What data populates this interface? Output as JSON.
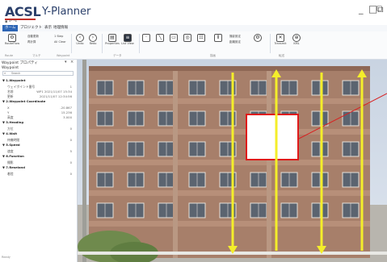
{
  "app": {
    "logo": "ACSL",
    "name": "Y-Planner"
  },
  "window": {
    "minimize_glyph": "_",
    "maximize_glyph": "□",
    "restore_glyph": "⧉"
  },
  "quick_access": "▪ ↶ ↷",
  "menu": {
    "tabs": [
      "ホーム",
      "プロジェクト",
      "表示",
      "地理情報"
    ],
    "active_index": 0
  },
  "ribbon": {
    "buttons": [
      {
        "label": "RouteFlow",
        "icon": "route-icon"
      },
      {
        "label": "ルート作成",
        "icon": "route-create-icon"
      },
      {
        "label": "1 Step",
        "icon": "step-icon"
      },
      {
        "label": "All Clear",
        "icon": "clear-icon"
      },
      {
        "label": "Undo",
        "icon": "undo-icon"
      },
      {
        "label": "Redo",
        "icon": "redo-icon"
      },
      {
        "label": "Properties",
        "icon": "properties-icon"
      },
      {
        "label": "List View",
        "icon": "list-icon"
      },
      {
        "label": "Transmit",
        "icon": "transmit-icon"
      },
      {
        "label": "KML",
        "icon": "kml-icon"
      }
    ],
    "options": [
      "自動更新",
      "再計算",
      "撮影設定",
      "距離設定"
    ],
    "groups": [
      "Route",
      "マルチ",
      "Waypoint",
      "データ",
      "描画",
      "転送"
    ]
  },
  "panel": {
    "title": "Waypoint プロパティ",
    "section": "Waypoint",
    "search_placeholder": "Search",
    "rows": [
      {
        "kind": "cat",
        "label": "▼ 1.Waypoint"
      },
      {
        "kind": "kv",
        "key": "ウェイポイント番号",
        "value": "1"
      },
      {
        "kind": "kv",
        "key": "名前",
        "value": "WP1 2021/11/07 15:34"
      },
      {
        "kind": "kv",
        "key": "更新",
        "value": "2021/11/07 12:34:56"
      },
      {
        "kind": "cat",
        "label": "▼ 2.Waypoint Coordinate"
      },
      {
        "kind": "kv",
        "key": "X",
        "value": "-20.867"
      },
      {
        "kind": "kv",
        "key": "Y",
        "value": "15.236"
      },
      {
        "kind": "kv",
        "key": "高度",
        "value": "3.000"
      },
      {
        "kind": "cat",
        "label": "▼ 3.Heading"
      },
      {
        "kind": "kv",
        "key": "方位",
        "value": "0"
      },
      {
        "kind": "cat",
        "label": "▼ 4.Wait"
      },
      {
        "kind": "kv",
        "key": "待機時間",
        "value": "0"
      },
      {
        "kind": "cat",
        "label": "▼ 5.Speed"
      },
      {
        "kind": "kv",
        "key": "速度",
        "value": "5"
      },
      {
        "kind": "cat",
        "label": "▼ 6.Function"
      },
      {
        "kind": "kv",
        "key": "撮影",
        "value": "0"
      },
      {
        "kind": "cat",
        "label": "▼ 7.Reseland"
      },
      {
        "kind": "kv",
        "key": "着陸",
        "value": "0"
      }
    ],
    "footer": "Ready"
  },
  "colors": {
    "accent": "#2e66b5",
    "flight_path": "#f4ee2a",
    "selection_box": "#e01a1a",
    "annotation_line": "#d82020"
  }
}
